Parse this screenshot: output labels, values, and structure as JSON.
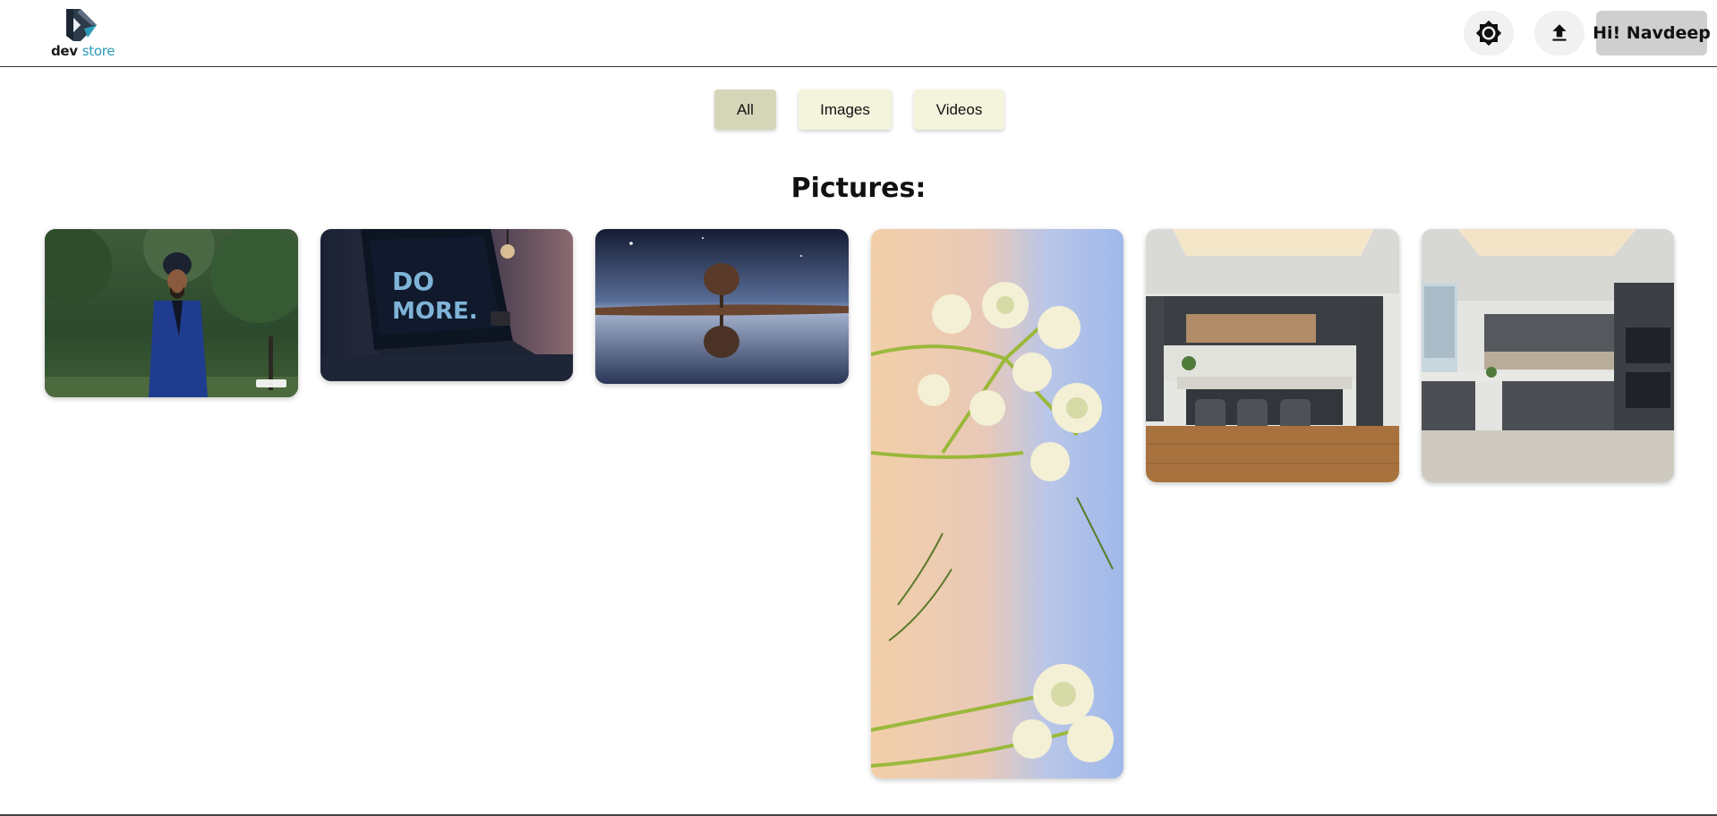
{
  "header": {
    "logo": {
      "word_dev": "dev",
      "word_store": "store",
      "brand_color": "#2a9bb8"
    },
    "theme_icon": "brightness-icon",
    "upload_icon": "upload-icon",
    "user_label": "Hi! Navdeep"
  },
  "filters": {
    "items": [
      {
        "label": "All",
        "active": true,
        "color": "#d5d6b8"
      },
      {
        "label": "Images",
        "active": false,
        "color": "#f4f4dd"
      },
      {
        "label": "Videos",
        "active": false,
        "color": "#f4f4dd"
      }
    ]
  },
  "gallery": {
    "title": "Pictures:",
    "images": [
      {
        "subject": "man in blue suit and turban outdoors"
      },
      {
        "subject": "laptop with DO MORE screen",
        "screen_text": "DO MORE."
      },
      {
        "subject": "lone tree reflected in water at night"
      },
      {
        "subject": "white wildflowers against sky"
      },
      {
        "subject": "modern kitchen with island and bar stools"
      },
      {
        "subject": "modern grey kitchen with window"
      }
    ]
  }
}
